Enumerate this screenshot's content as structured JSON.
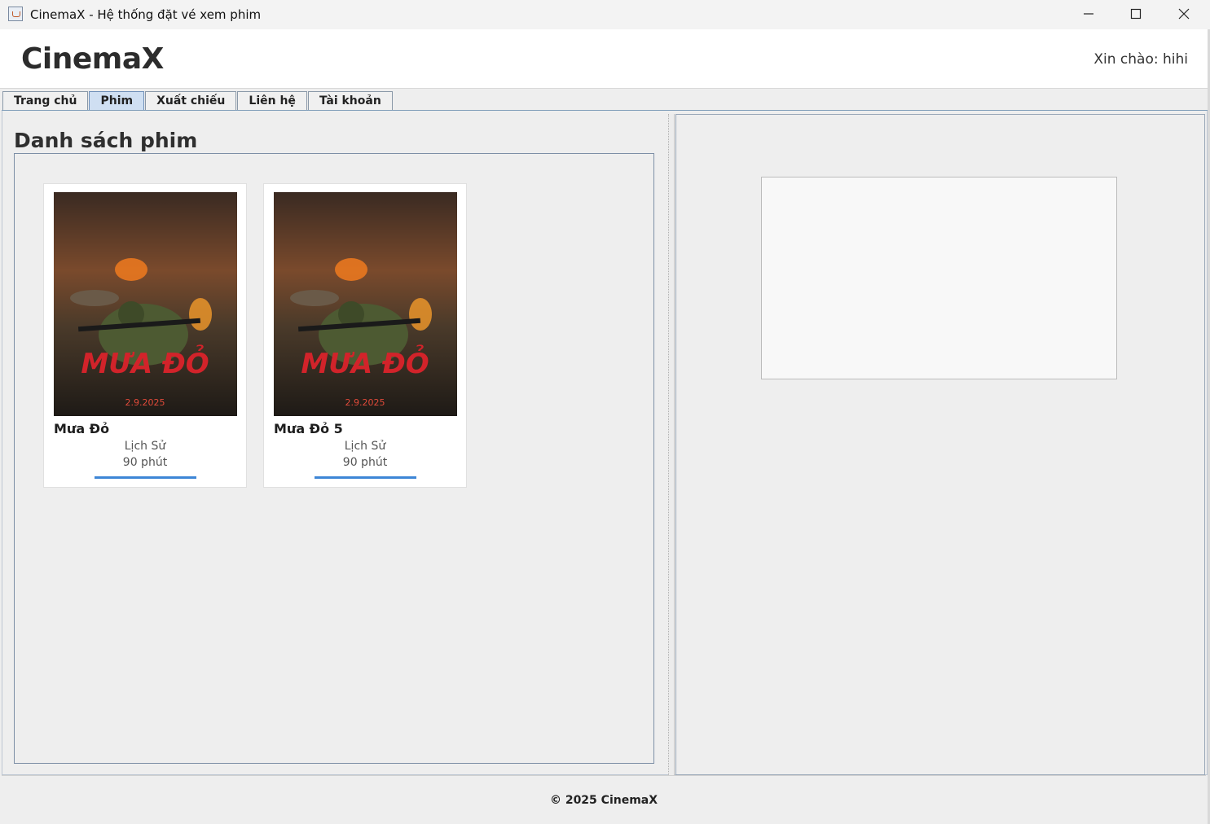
{
  "window": {
    "title": "CinemaX - Hệ thống đặt vé xem phim",
    "minimize_icon": "minimize-icon",
    "maximize_icon": "maximize-icon",
    "close_icon": "close-icon"
  },
  "header": {
    "brand": "CinemaX",
    "greeting": "Xin chào: hihi"
  },
  "tabs": [
    {
      "label": "Trang chủ",
      "active": false
    },
    {
      "label": "Phim",
      "active": true
    },
    {
      "label": "Xuất chiếu",
      "active": false
    },
    {
      "label": "Liên hệ",
      "active": false
    },
    {
      "label": "Tài khoản",
      "active": false
    }
  ],
  "movie_list": {
    "title": "Danh sách phim",
    "movies": [
      {
        "name": "Mưa Đỏ",
        "genre": "Lịch Sử",
        "duration": "90 phút",
        "poster_title": "MƯA ĐỎ",
        "poster_date": "2.9.2025"
      },
      {
        "name": "Mưa Đỏ 5",
        "genre": "Lịch Sử",
        "duration": "90 phút",
        "poster_title": "MƯA ĐỎ",
        "poster_date": "2.9.2025"
      }
    ]
  },
  "footer": {
    "text": "© 2025 CinemaX"
  },
  "colors": {
    "accent_bar": "#3d86d6",
    "active_tab": "#cfdff2",
    "poster_red": "#d2232a"
  }
}
